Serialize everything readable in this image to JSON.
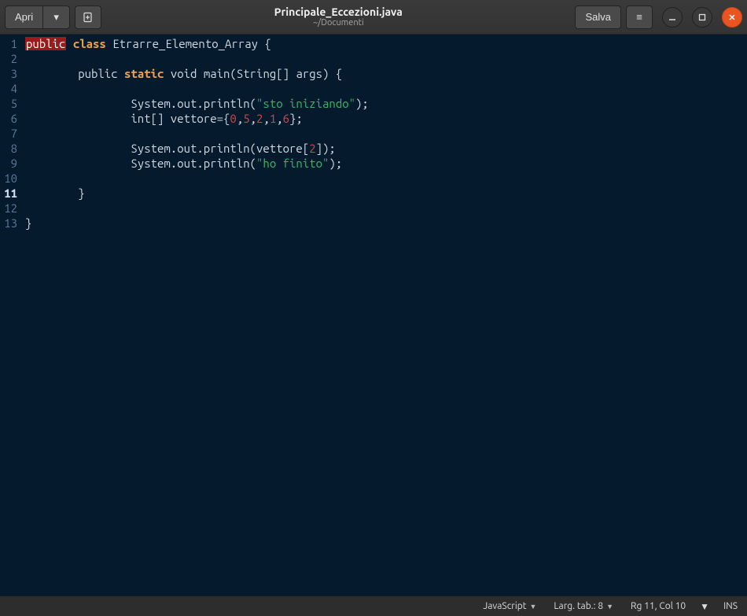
{
  "header": {
    "open_label": "Apri",
    "save_label": "Salva",
    "title": "Principale_Eccezioni.java",
    "subtitle": "~/Documenti"
  },
  "code": {
    "lines": [
      {
        "n": 1,
        "tokens": [
          [
            "kw-public",
            "public"
          ],
          [
            "space",
            " "
          ],
          [
            "kw-orange",
            "class"
          ],
          [
            "space",
            " "
          ],
          [
            "ident",
            "Etrarre_Elemento_Array"
          ],
          [
            "space",
            " "
          ],
          [
            "punct",
            "{"
          ]
        ]
      },
      {
        "n": 2,
        "tokens": []
      },
      {
        "n": 3,
        "tokens": [
          [
            "space",
            "        "
          ],
          [
            "ident",
            "public"
          ],
          [
            "space",
            " "
          ],
          [
            "kw-orange",
            "static"
          ],
          [
            "space",
            " "
          ],
          [
            "void",
            "void"
          ],
          [
            "space",
            " "
          ],
          [
            "ident",
            "main(String[] args)"
          ],
          [
            "space",
            " "
          ],
          [
            "punct",
            "{"
          ]
        ]
      },
      {
        "n": 4,
        "tokens": []
      },
      {
        "n": 5,
        "tokens": [
          [
            "space",
            "                "
          ],
          [
            "ident",
            "System.out.println("
          ],
          [
            "str",
            "\"sto iniziando\""
          ],
          [
            "ident",
            ");"
          ]
        ]
      },
      {
        "n": 6,
        "tokens": [
          [
            "space",
            "                "
          ],
          [
            "ident",
            "int[] vettore={"
          ],
          [
            "num",
            "0"
          ],
          [
            "punct",
            ","
          ],
          [
            "num",
            "5"
          ],
          [
            "punct",
            ","
          ],
          [
            "num",
            "2"
          ],
          [
            "punct",
            ","
          ],
          [
            "num",
            "1"
          ],
          [
            "punct",
            ","
          ],
          [
            "num",
            "6"
          ],
          [
            "ident",
            "};"
          ]
        ]
      },
      {
        "n": 7,
        "tokens": []
      },
      {
        "n": 8,
        "tokens": [
          [
            "space",
            "                "
          ],
          [
            "ident",
            "System.out.println(vettore["
          ],
          [
            "num",
            "2"
          ],
          [
            "ident",
            "]);"
          ]
        ]
      },
      {
        "n": 9,
        "tokens": [
          [
            "space",
            "                "
          ],
          [
            "ident",
            "System.out.println("
          ],
          [
            "str",
            "\"ho finito\""
          ],
          [
            "ident",
            ");"
          ]
        ]
      },
      {
        "n": 10,
        "tokens": []
      },
      {
        "n": 11,
        "tokens": [
          [
            "space",
            "        "
          ],
          [
            "punct",
            "}"
          ]
        ],
        "cursor": true
      },
      {
        "n": 12,
        "tokens": []
      },
      {
        "n": 13,
        "tokens": [
          [
            "punct",
            "}"
          ]
        ]
      }
    ]
  },
  "status": {
    "language": "JavaScript",
    "tab_width": "Larg. tab.: 8",
    "position": "Rg 11, Col 10",
    "insert_mode": "INS"
  }
}
